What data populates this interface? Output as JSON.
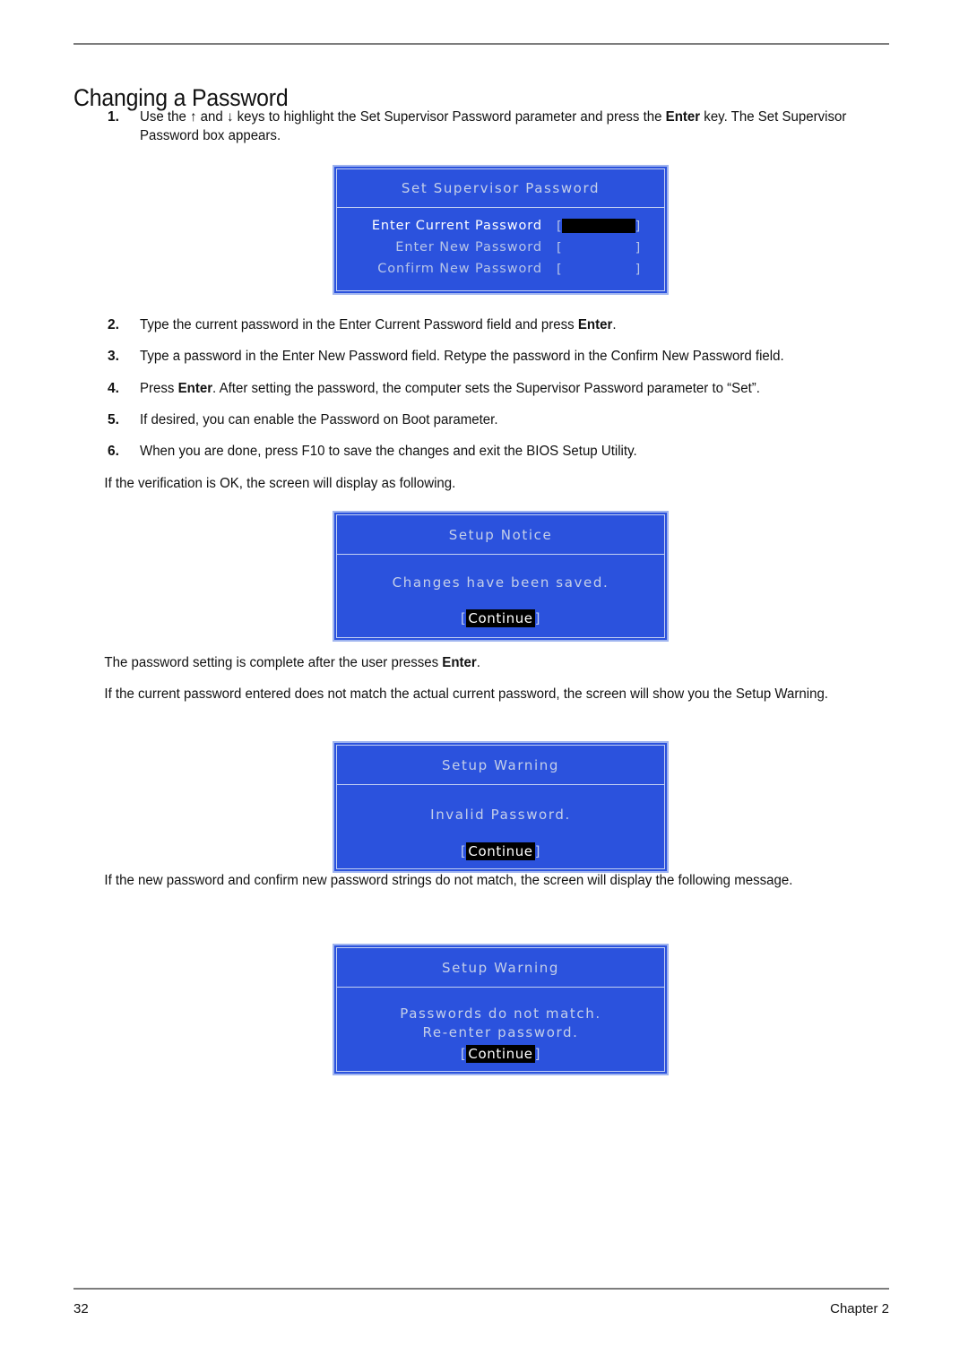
{
  "document": {
    "heading": "Changing a Password",
    "footer": {
      "page_number": "32",
      "chapter": "Chapter 2"
    }
  },
  "steps": [
    {
      "number": "1.",
      "parts": [
        {
          "text": "Use the ↑ and ↓ keys to highlight the Set Supervisor Password parameter and press the ",
          "bold": false
        },
        {
          "text": "Enter",
          "bold": true
        },
        {
          "text": " key. The Set Supervisor Password box appears.",
          "bold": false
        }
      ]
    },
    {
      "number": "2.",
      "parts": [
        {
          "text": "Type the current password in the Enter Current Password field and press ",
          "bold": false
        },
        {
          "text": "Enter",
          "bold": true
        },
        {
          "text": ".",
          "bold": false
        }
      ]
    },
    {
      "number": "3.",
      "parts": [
        {
          "text": "Type a password in the Enter New Password field. Retype the password in the Confirm New Password field.",
          "bold": false
        }
      ]
    },
    {
      "number": "4.",
      "parts": [
        {
          "text": "Press ",
          "bold": false
        },
        {
          "text": "Enter",
          "bold": true
        },
        {
          "text": ". After setting the password, the computer sets the Supervisor Password parameter to “Set”.",
          "bold": false
        }
      ]
    },
    {
      "number": "5.",
      "parts": [
        {
          "text": "If desired, you can enable the Password on Boot parameter.",
          "bold": false
        }
      ]
    },
    {
      "number": "6.",
      "parts": [
        {
          "text": "When you are done, press F10 to save the changes and exit the BIOS Setup Utility.",
          "bold": false
        }
      ]
    }
  ],
  "paragraphs": {
    "after_steps": "If the verification is OK, the screen will display as following.",
    "after_notice": [
      {
        "text": "The password setting is complete after the user presses ",
        "bold": false
      },
      {
        "text": "Enter",
        "bold": true
      },
      {
        "text": ".",
        "bold": false
      }
    ],
    "before_invalid": "If the current password entered does not match the actual current password, the screen will show you the Setup Warning.",
    "before_mismatch": "If the new password and confirm new password strings do not match, the screen will display the following message."
  },
  "dialogs": {
    "supervisor": {
      "title": "Set Supervisor Password",
      "fields": [
        {
          "label": "Enter Current Password",
          "state": "active",
          "filled": true
        },
        {
          "label": "Enter New Password",
          "state": "dim",
          "filled": false
        },
        {
          "label": "Confirm New Password",
          "state": "dim",
          "filled": false
        }
      ],
      "bracket_open": "[",
      "bracket_close": "]"
    },
    "notice": {
      "title": "Setup Notice",
      "message": "Changes have been saved.",
      "button": "Continue",
      "bracket_open": "[",
      "bracket_close": "]"
    },
    "warning_invalid": {
      "title": "Setup Warning",
      "message": "Invalid Password.",
      "button": "Continue",
      "bracket_open": "[",
      "bracket_close": "]"
    },
    "warning_mismatch": {
      "title": "Setup Warning",
      "message_line1": "Passwords do not match.",
      "message_line2": "Re-enter password.",
      "button": "Continue",
      "bracket_open": "[",
      "bracket_close": "]"
    }
  },
  "colors": {
    "dialog_background": "#2b52dd",
    "dialog_border": "#9fb4ef",
    "dialog_text_dim": "#c4cfe9",
    "dialog_text_active": "#ffffff",
    "button_background": "#000000",
    "rule": "#7d7d7d"
  }
}
